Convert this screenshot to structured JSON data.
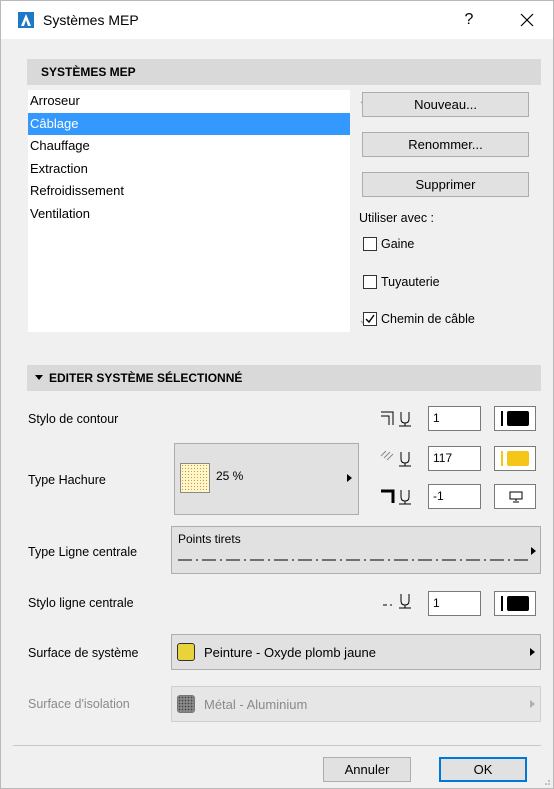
{
  "window": {
    "title": "Systèmes MEP",
    "help": "?",
    "close": "✕"
  },
  "systems_section": {
    "title": "SYSTÈMES MEP",
    "items": [
      "Arroseur",
      "Câblage",
      "Chauffage",
      "Extraction",
      "Refroidissement",
      "Ventilation"
    ],
    "selected_index": 1,
    "buttons": {
      "new": "Nouveau...",
      "rename": "Renommer...",
      "delete": "Supprimer"
    },
    "use_with_label": "Utiliser avec :",
    "use_with": [
      {
        "label": "Gaine",
        "checked": false
      },
      {
        "label": "Tuyauterie",
        "checked": false
      },
      {
        "label": "Chemin de câble",
        "checked": true
      }
    ]
  },
  "edit_section": {
    "title": "EDITER SYSTÈME SÉLECTIONNÉ",
    "contour_pen": {
      "label": "Stylo de contour",
      "value": "1",
      "color": "#000000"
    },
    "hatch_type": {
      "label": "Type Hachure",
      "pattern": "25 %",
      "fg_pen": {
        "value": "117",
        "color": "#f5c518"
      },
      "bg_pen": {
        "value": "-1"
      }
    },
    "center_line_type": {
      "label": "Type Ligne centrale",
      "value": "Points tirets"
    },
    "center_line_pen": {
      "label": "Stylo ligne centrale",
      "value": "1",
      "color": "#000000"
    },
    "system_surface": {
      "label": "Surface de système",
      "value": "Peinture - Oxyde plomb jaune",
      "color": "#e8d43a"
    },
    "insulation_surface": {
      "label": "Surface d'isolation",
      "value": "Métal - Aluminium",
      "enabled": false
    }
  },
  "footer": {
    "cancel": "Annuler",
    "ok": "OK"
  }
}
